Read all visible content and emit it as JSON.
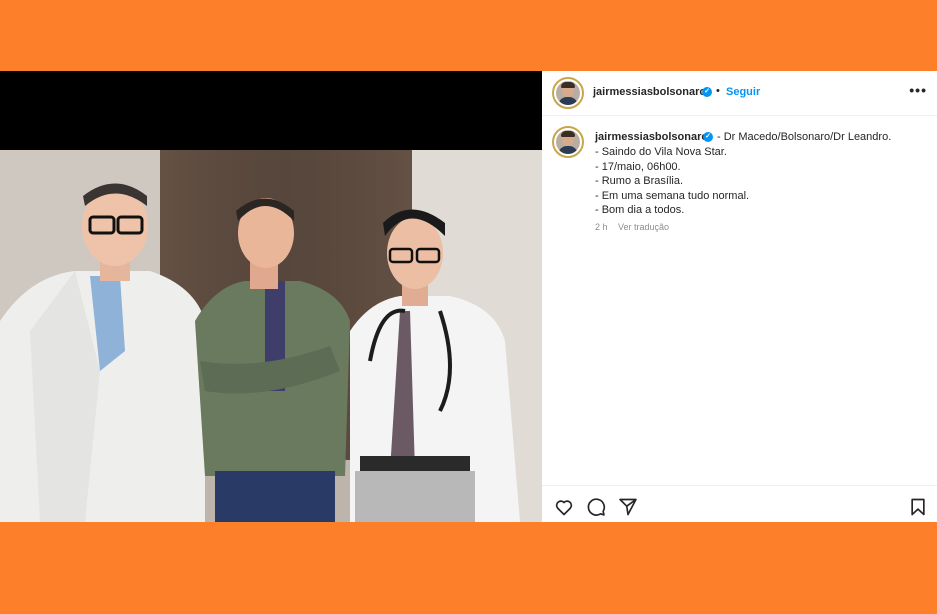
{
  "post": {
    "username": "jairmessiasbolsonaro",
    "follow_label": "Seguir",
    "separator": "•",
    "more_label": "•••"
  },
  "caption": {
    "username": "jairmessiasbolsonaro",
    "first_line": "- Dr Macedo/Bolsonaro/Dr Leandro.",
    "lines": [
      "- Saindo do Vila Nova Star.",
      "- 17/maio, 06h00.",
      "- Rumo a Brasília.",
      "- Em uma semana tudo normal.",
      "- Bom dia a todos."
    ],
    "time": "2 h",
    "translate_label": "Ver tradução"
  },
  "icons": {
    "verified": "verified-badge-icon",
    "like": "heart-icon",
    "comment": "comment-icon",
    "share": "send-icon",
    "save": "bookmark-icon"
  },
  "colors": {
    "background": "#fe7f2a",
    "accent": "#0095f6",
    "text": "#262626",
    "muted": "#8e8e8e"
  }
}
